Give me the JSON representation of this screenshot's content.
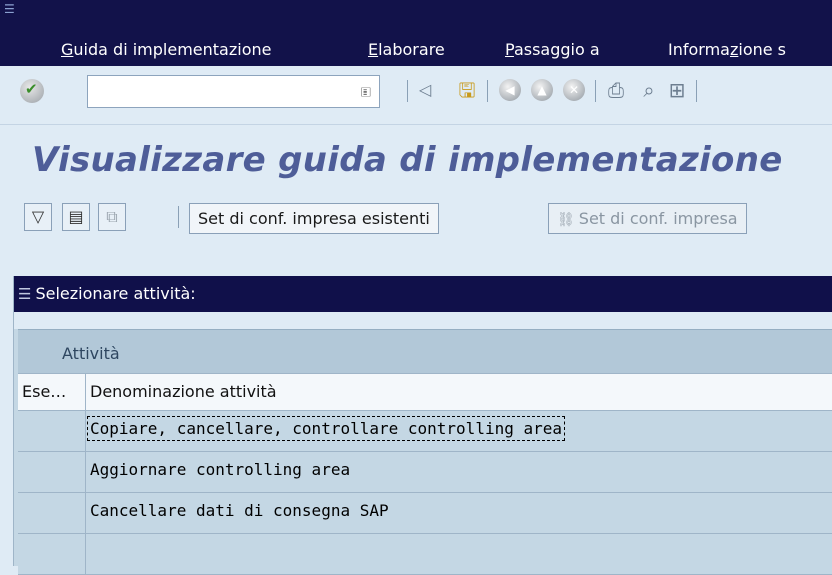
{
  "menubar": {
    "items": [
      {
        "pre": "",
        "u": "G",
        "post": "uida di implementazione"
      },
      {
        "pre": "",
        "u": "E",
        "post": "laborare"
      },
      {
        "pre": "",
        "u": "P",
        "post": "assaggio a"
      },
      {
        "pre": "Informa",
        "u": "z",
        "post": "ione s"
      }
    ]
  },
  "toolbar": {
    "command_value": "",
    "select_glyph": "🗉"
  },
  "title": "Visualizzare guida di implementazione",
  "app_toolbar": {
    "btn_existing": "Set di conf. impresa esistenti",
    "btn_disabled": "Set di conf. impresa"
  },
  "panel": {
    "title": "Selezionare attività:",
    "group_label": "Attività",
    "col_exec": "Ese…",
    "col_name": "Denominazione attività",
    "rows": [
      "Copiare, cancellare, controllare controlling area",
      "Aggiornare controlling area",
      "Cancellare dati di consegna SAP"
    ]
  }
}
